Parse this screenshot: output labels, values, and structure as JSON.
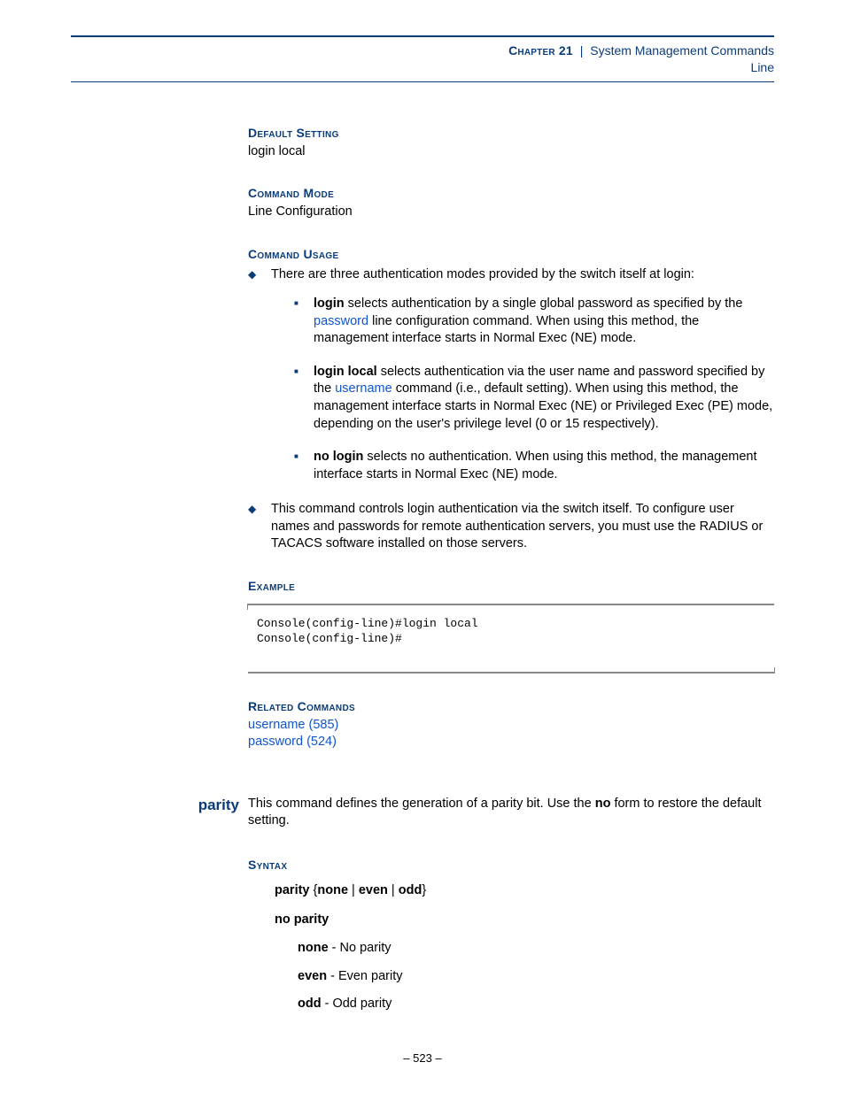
{
  "header": {
    "chapter_label": "Chapter 21",
    "chapter_title": "System Management Commands",
    "sub": "Line"
  },
  "sections": {
    "default_setting": {
      "label": "Default Setting",
      "text": "login local"
    },
    "command_mode": {
      "label": "Command Mode",
      "text": "Line Configuration"
    },
    "command_usage": {
      "label": "Command Usage"
    },
    "example": {
      "label": "Example"
    },
    "related": {
      "label": "Related Commands"
    },
    "syntax": {
      "label": "Syntax"
    }
  },
  "usage": {
    "intro": "There are three authentication modes provided by the switch itself at login:",
    "login": {
      "kw": "login",
      "pre": " selects authentication by a single global password as specified by the ",
      "link": "password",
      "post": " line configuration command. When using this method, the management interface starts in Normal Exec (NE) mode."
    },
    "login_local": {
      "kw": "login local",
      "pre": " selects authentication via the user name and password specified by the ",
      "link": "username",
      "post": " command (i.e., default setting). When using this method, the management interface starts in Normal Exec (NE) or Privileged Exec (PE) mode, depending on the user's privilege level (0 or 15 respectively)."
    },
    "no_login": {
      "kw": "no login",
      "post": " selects no authentication. When using this method, the management interface starts in Normal Exec (NE) mode."
    },
    "second_bullet": "This command controls login authentication via the switch itself. To configure user names and passwords for remote authentication servers, you must use the RADIUS or TACACS software installed on those servers."
  },
  "example_code": "Console(config-line)#login local\nConsole(config-line)#",
  "related_links": {
    "username": "username (585)",
    "password": "password (524)"
  },
  "parity": {
    "name": "parity",
    "desc_pre": "This command defines the generation of a parity bit. Use the ",
    "desc_kw": "no",
    "desc_post": " form to restore the default setting.",
    "syntax_cmd": "parity",
    "opt_none": "none",
    "opt_even": "even",
    "opt_odd": "odd",
    "no_cmd": "no parity",
    "none_desc": " - No parity",
    "even_desc": " - Even parity",
    "odd_desc": " - Odd parity"
  },
  "glyphs": {
    "lbrace": "{",
    "rbrace": "}",
    "pipe": " | "
  },
  "footer": "– 523 –"
}
